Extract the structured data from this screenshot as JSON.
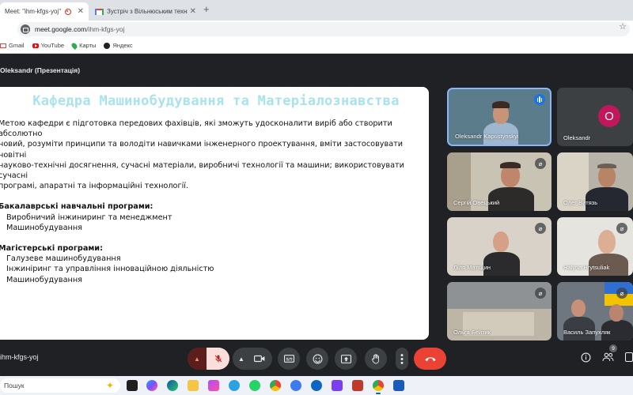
{
  "browser": {
    "tabs": [
      {
        "title": "Meet: \"ihm-kfgs-yoj\"",
        "active": true
      },
      {
        "title": "Зустріч з Вільнюським технічн",
        "active": false
      }
    ],
    "new_tab": "+",
    "url_host": "meet.google.com",
    "url_path": "/ihm-kfgs-yoj",
    "bookmarks": [
      "Gmail",
      "YouTube",
      "Карты",
      "Яндекс"
    ]
  },
  "meet": {
    "presenter_label": "Oleksandr (Презентація)",
    "meeting_code": "ihm-kfgs-yoj",
    "participants_badge": "9"
  },
  "slide": {
    "title": "Кафедра Машинобудування та Матеріалознавства",
    "intro_lines": [
      "Метою кафедри є підготовка передових фахівців, які зможуть удосконалити виріб або створити абсолютно",
      "новий, розуміти принципи та володіти навичками інженерного проектування, вміти застосовувати новітні",
      "науково-технічні досягнення, сучасні матеріали, виробничі технології та машини; використовувати сучасні",
      "програмі, апаратні та інформаційні технології."
    ],
    "bachelor_heading": "Бакалаврські навчальні програми:",
    "bachelor_items": [
      "Виробничий інжиниринг та менеджмент",
      "Машинобудування"
    ],
    "master_heading": "Магістерські програми:",
    "master_items": [
      "Галузеве машинобудування",
      "Інжиніринг та управління інноваційною діяльністю",
      "Машинобудування"
    ]
  },
  "participants": [
    {
      "name": "Oleksandr Kapustynskyi",
      "speaking": true
    },
    {
      "name": "Oleksandr",
      "avatar_letter": "O",
      "avatar_color": "#c2185b"
    },
    {
      "name": "Сергій Овецький",
      "muted": true
    },
    {
      "name": "Олег Витязь"
    },
    {
      "name": "Ліля Матіщин",
      "muted": true
    },
    {
      "name": "Halyna Hrytsuliak",
      "muted": true
    },
    {
      "name": "Ольга Бейзик",
      "muted": true
    },
    {
      "name": "Василь Запухляк",
      "muted": true
    }
  ],
  "controls": {
    "mic": "mic-off-icon",
    "camera": "videocam-icon",
    "captions": "captions-icon",
    "emoji": "emoji-icon",
    "present": "present-icon",
    "hand": "raise-hand-icon",
    "more": "more-vert-icon",
    "end_call": "call-end-icon",
    "info": "info-icon",
    "people": "people-icon"
  },
  "taskbar": {
    "search_placeholder": "Пошук"
  },
  "colors": {
    "meet_bg": "#202124",
    "end_call": "#ea4335",
    "mic_off_bg": "#f9dedc",
    "slide_title": "#a8e3ec",
    "active_tile_border": "#8ab4f8"
  }
}
